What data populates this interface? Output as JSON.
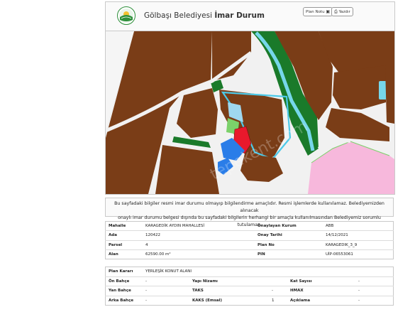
{
  "header": {
    "title_prefix": "Gölbaşı Belediyesi ",
    "title_bold": "İmar Durum",
    "plan_note_button": "Plan Notu",
    "print_button": "Yazdır"
  },
  "map": {
    "watermark": "tepekent.com"
  },
  "notice": {
    "line1": "Bu sayfadaki bilgiler resmi imar durumu olmayıp bilgilendirme amaçlıdır. Resmi işlemlerde kullanılamaz. Belediyemizden alınacak",
    "line2": "onaylı imar durumu belgesi dışında bu sayfadaki bilgilerin herhangi bir amaçla kullanılmasından Belediyemiz sorumlu tutulamaz."
  },
  "parcel_info": {
    "rows": [
      {
        "l1": "Mahalle",
        "v1": "KARAGEDİK AYDIN MAHALLESİ",
        "l2": "Onaylayan Kurum",
        "v2": "ABB"
      },
      {
        "l1": "Ada",
        "v1": "120422",
        "l2": "Onay Tarihi",
        "v2": "14/12/2021"
      },
      {
        "l1": "Parsel",
        "v1": "4",
        "l2": "Plan No",
        "v2": "KARAGEDIK_3_9"
      },
      {
        "l1": "Alan",
        "v1": "62590.00 m²",
        "l2": "PIN",
        "v2": "UİP-06553061"
      }
    ]
  },
  "plan_info": {
    "plan_karari_label": "Plan Kararı",
    "plan_karari_value": "YERLEŞİK KONUT ALANI",
    "rows": [
      {
        "c1": "Ön Bahçe",
        "c2": "-",
        "c3": "Yapı Nizamı",
        "c4": "",
        "c5": "Kat Sayısı",
        "c6": "-"
      },
      {
        "c1": "Yan Bahçe",
        "c2": "-",
        "c3": "TAKS",
        "c4": "-",
        "c5": "HMAX",
        "c6": "-"
      },
      {
        "c1": "Arka Bahçe",
        "c2": "-",
        "c3": "KAKS (Emsal)",
        "c4": "1",
        "c5": "Açıklama",
        "c6": "-"
      }
    ]
  },
  "colors": {
    "residential": "#7a3d17",
    "green_area": "#1a7a2a",
    "water": "#76d7ea",
    "commercial": "#f7b8dc",
    "selected_parcel": "#e8192c",
    "school": "#2a7de8",
    "parcel_outline": "#4cc9e8"
  }
}
